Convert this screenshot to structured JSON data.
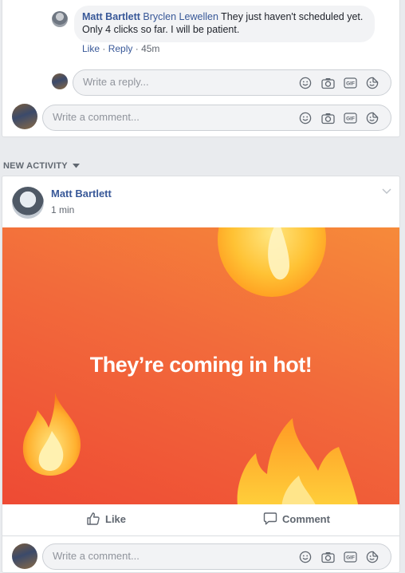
{
  "comment": {
    "author": "Matt Bartlett",
    "tagged": "Bryclen Lewellen",
    "text": "They just haven't scheduled yet. Only 4 clicks so far. I will be patient.",
    "like": "Like",
    "reply": "Reply",
    "sep1": "·",
    "sep2": "·",
    "time": "45m"
  },
  "reply_box": {
    "placeholder": "Write a reply..."
  },
  "comment_box_top": {
    "placeholder": "Write a comment..."
  },
  "section": {
    "label": "NEW ACTIVITY"
  },
  "post": {
    "author": "Matt Bartlett",
    "time": "1 min",
    "banner_text": "They’re coming in hot!",
    "like_label": "Like",
    "comment_label": "Comment"
  },
  "comment_box_bottom": {
    "placeholder": "Write a comment..."
  },
  "icons": {
    "emoji": "smiley-icon",
    "camera": "camera-icon",
    "gif": "gif-icon",
    "sticker": "sticker-icon"
  },
  "colors": {
    "link": "#385898",
    "banner_top": "#f68a3a",
    "banner_bottom": "#ee4a34",
    "background": "#e9ebee"
  }
}
